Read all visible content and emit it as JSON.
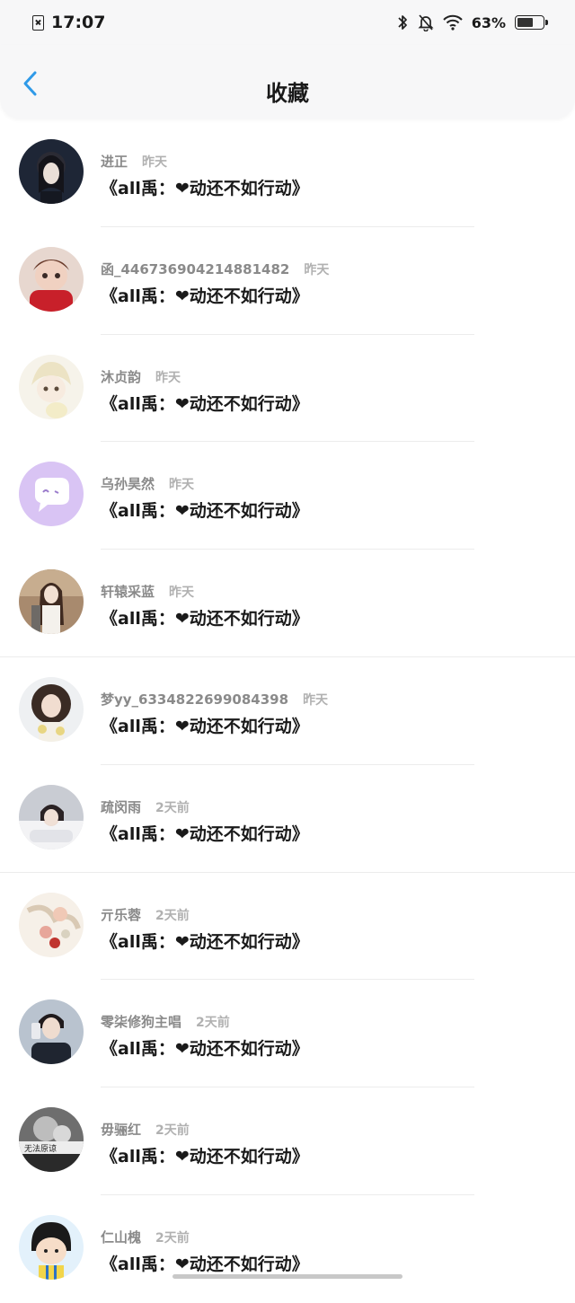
{
  "status_bar": {
    "time": "17:07",
    "battery": "63%",
    "battery_level": 0.63,
    "icons": [
      "sim-icon",
      "bluetooth-icon",
      "mute-icon",
      "wifi-icon",
      "battery-icon"
    ]
  },
  "header": {
    "title": "收藏",
    "back_icon": "chevron-left-icon",
    "accent": "#2f9ae8"
  },
  "items": [
    {
      "name": "进正",
      "time": "昨天",
      "message": "《all禹：❤动还不如行动》",
      "avatar": "avatar-girl-dark"
    },
    {
      "name": "函_446736904214881482",
      "time": "昨天",
      "message": "《all禹：❤动还不如行动》",
      "avatar": "avatar-doll-red"
    },
    {
      "name": "沐贞韵",
      "time": "昨天",
      "message": "《all禹：❤动还不如行动》",
      "avatar": "avatar-anime-cat"
    },
    {
      "name": "乌孙昊然",
      "time": "昨天",
      "message": "《all禹：❤动还不如行动》",
      "avatar": "avatar-default-purple"
    },
    {
      "name": "轩辕采蓝",
      "time": "昨天",
      "message": "《all禹：❤动还不如行动》",
      "avatar": "avatar-girl-brown"
    },
    {
      "name": "梦yy_6334822699084398",
      "time": "昨天",
      "message": "《all禹：❤动还不如行动》",
      "avatar": "avatar-girl-curly"
    },
    {
      "name": "疏闵雨",
      "time": "2天前",
      "message": "《all禹：❤动还不如行动》",
      "avatar": "avatar-girl-lying"
    },
    {
      "name": "亓乐蓉",
      "time": "2天前",
      "message": "《all禹：❤动还不如行动》",
      "avatar": "avatar-flowers"
    },
    {
      "name": "零柒修狗主唱",
      "time": "2天前",
      "message": "《all禹：❤动还不如行动》",
      "avatar": "avatar-boy-phone"
    },
    {
      "name": "毋骊红",
      "time": "2天前",
      "message": "《all禹：❤动还不如行动》",
      "avatar": "avatar-bw-text",
      "avatar_text": "无法原谅"
    },
    {
      "name": "仁山槐",
      "time": "2天前",
      "message": "《all禹：❤动还不如行动》",
      "avatar": "avatar-cartoon-girl"
    }
  ]
}
